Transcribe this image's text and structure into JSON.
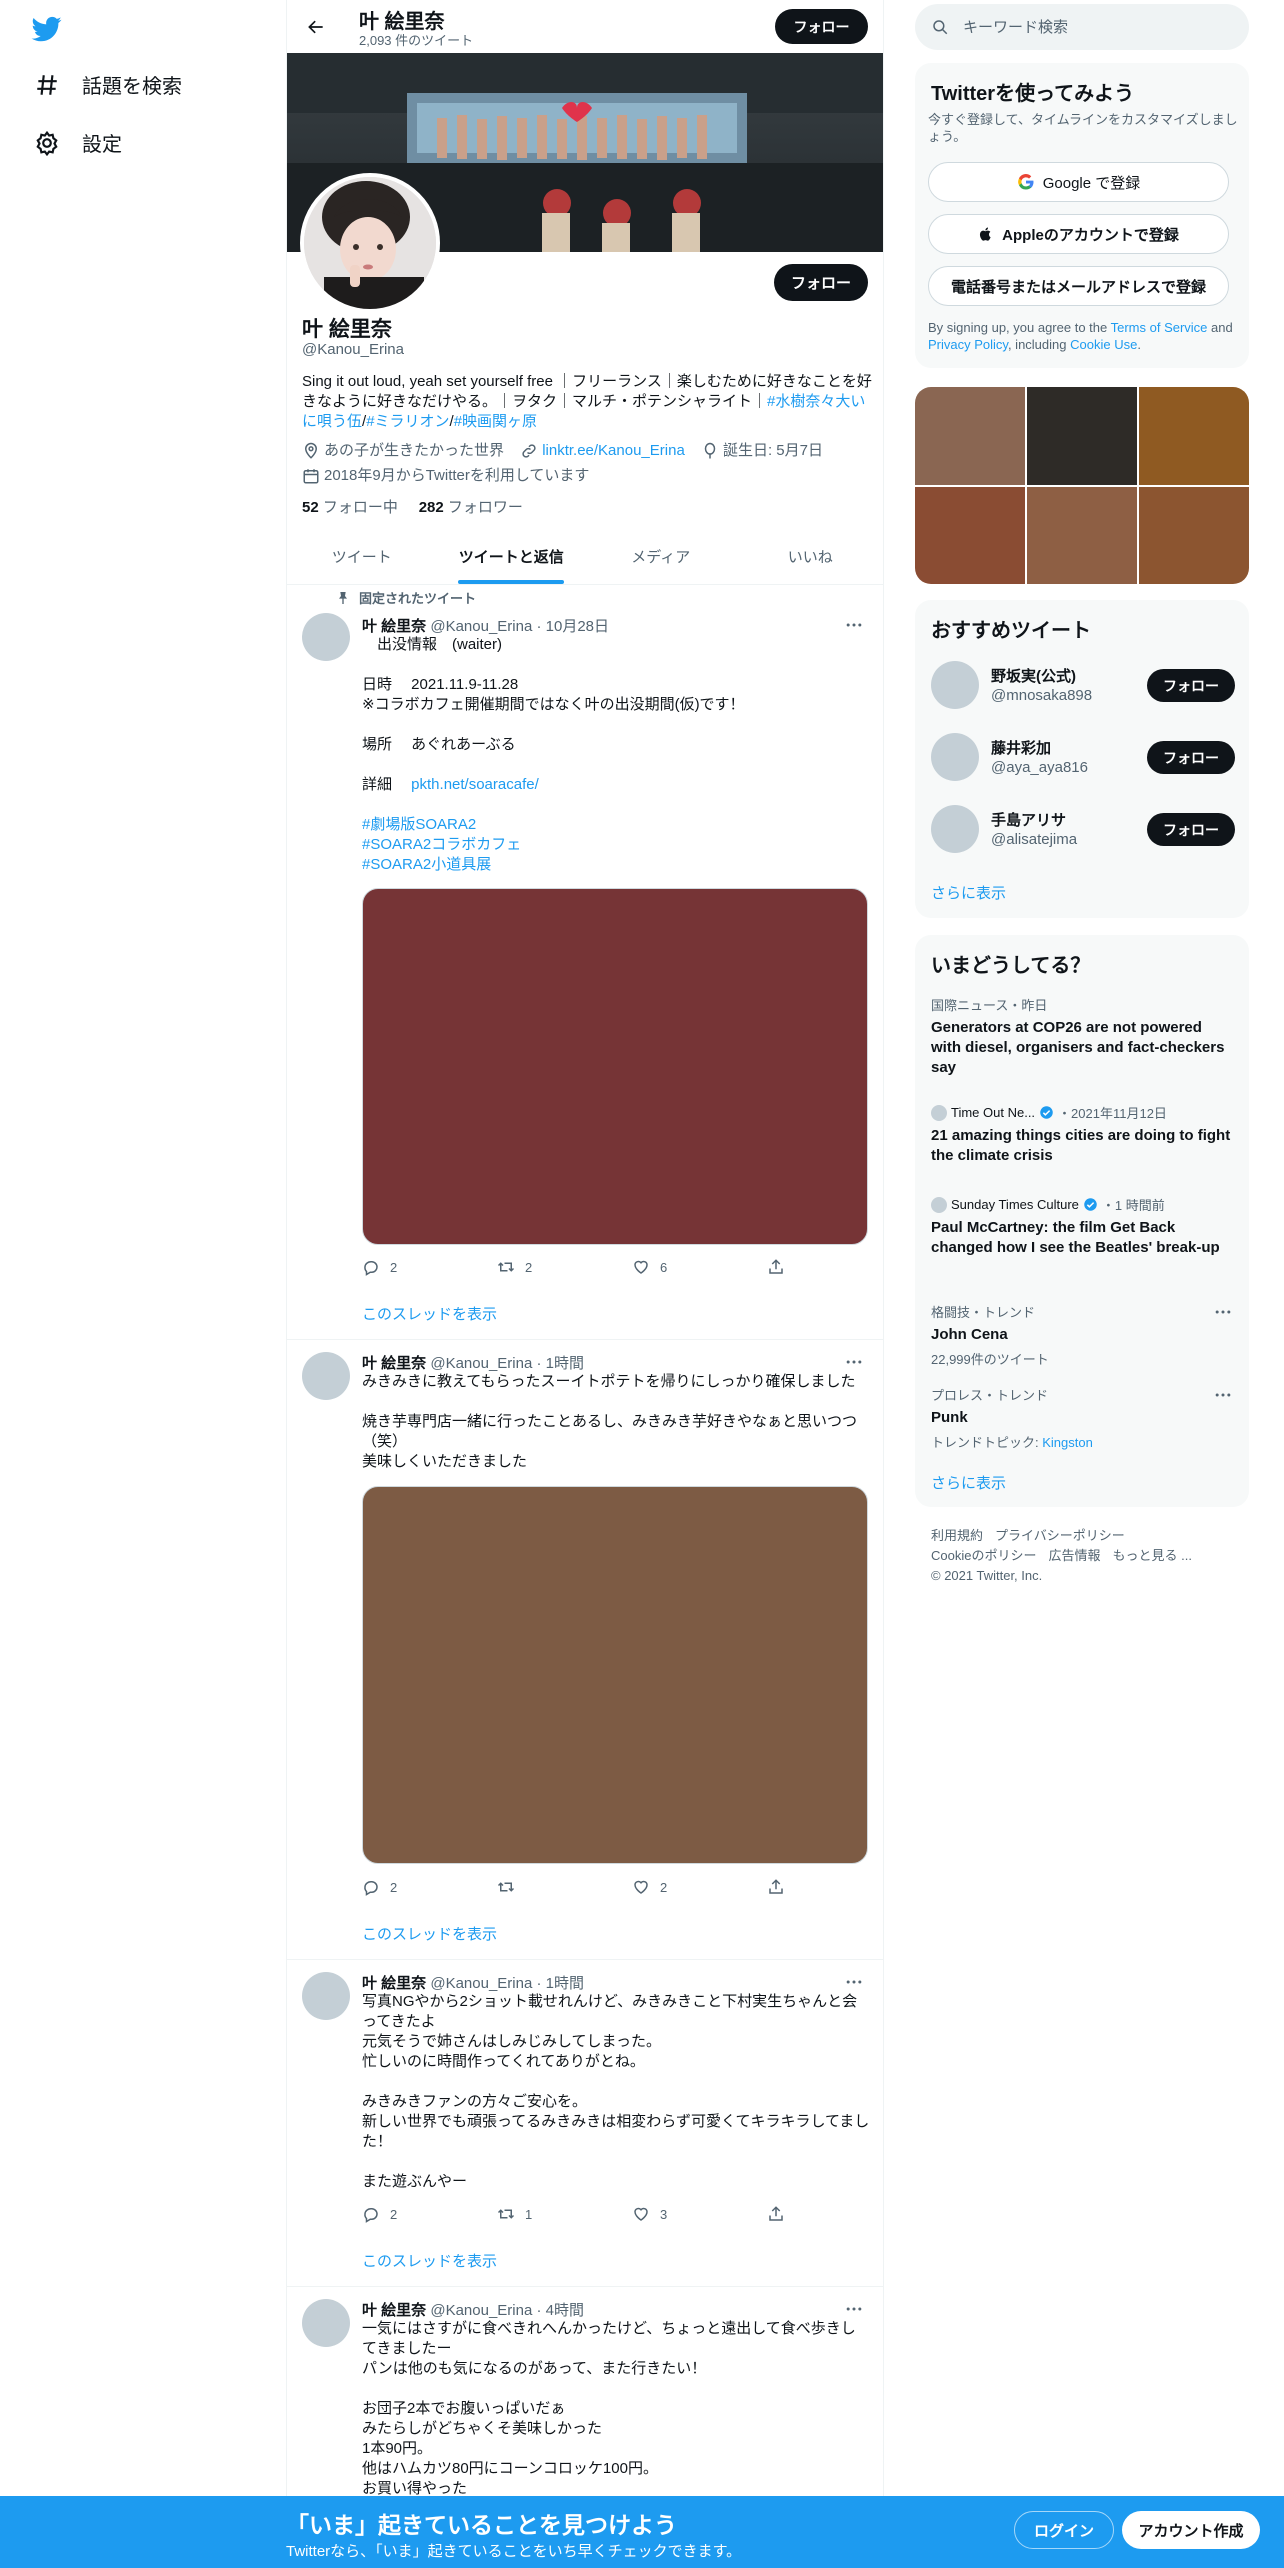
{
  "nav": {
    "explore_label": "話題を検索",
    "settings_label": "設定"
  },
  "header": {
    "name": "叶 絵里奈",
    "tweet_count": "2,093 件のツイート",
    "follow_label": "フォロー"
  },
  "profile": {
    "name": "叶 絵里奈",
    "handle": "@Kanou_Erina",
    "follow_label": "フォロー",
    "bio_text": "Sing it out loud, yeah set yourself free ｜フリーランス｜楽しむために好きなことを好きなように好きなだけやる。｜ヲタク｜マルチ・ポテンシャライト｜",
    "bio_tags": [
      "#水樹奈々大いに唄う伍",
      "#ミラリオン",
      "#映画関ヶ原"
    ],
    "location": "あの子が生きたかった世界",
    "link": "linktr.ee/Kanou_Erina",
    "birthday": "誕生日: 5月7日",
    "joined": "2018年9月からTwitterを利用しています",
    "following_count": "52",
    "following_label": "フォロー中",
    "followers_count": "282",
    "followers_label": "フォロワー"
  },
  "tabs": [
    "ツイート",
    "ツイートと返信",
    "メディア",
    "いいね"
  ],
  "active_tab": "ツイートと返信",
  "pinned_label": "固定されたツイート",
  "tweets": [
    {
      "name": "叶 絵里奈",
      "handle_time": "@Kanou_Erina · 10月28日",
      "text": "　出没情報　(waiter)\n\n日時　 2021.11.9-11.28\n※コラボカフェ開催期間ではなく叶の出没期間(仮)です！\n\n場所　 あぐれあーぶる\n\n詳細　 ",
      "link": "pkth.net/soaracafe/",
      "hashtags": [
        "#劇場版SOARA2",
        "#SOARA2コラボカフェ",
        "#SOARA2小道具展"
      ],
      "media_color": "#763436",
      "replies": "2",
      "retweets": "2",
      "likes": "6",
      "thread_label": "このスレッドを表示"
    },
    {
      "name": "叶 絵里奈",
      "handle_time": "@Kanou_Erina · 1時間",
      "text": "みきみきに教えてもらったスーイトポテトを帰りにしっかり確保しました\n\n焼き芋専門店一緒に行ったことあるし、みきみき芋好きやなぁと思いつつ（笑）\n美味しくいただきました",
      "media_color": "#7d5b44",
      "replies": "2",
      "retweets": "",
      "likes": "2",
      "thread_label": "このスレッドを表示"
    },
    {
      "name": "叶 絵里奈",
      "handle_time": "@Kanou_Erina · 1時間",
      "text": "写真NGやから2ショット載せれんけど、みきみきこと下村実生ちゃんと会ってきたよ\n元気そうで姉さんはしみじみしてしまった。\n忙しいのに時間作ってくれてありがとね。\n\nみきみきファンの方々ご安心を。\n新しい世界でも頑張ってるみきみきは相変わらず可愛くてキラキラしてました！\n\nまた遊ぶんやー",
      "replies": "2",
      "retweets": "1",
      "likes": "3",
      "thread_label": "このスレッドを表示"
    },
    {
      "name": "叶 絵里奈",
      "handle_time": "@Kanou_Erina · 4時間",
      "text": "一気にはさすがに食べきれへんかったけど、ちょっと遠出して食べ歩きしてきましたー\nパンは他のも気になるのがあって、また行きたい！\n\nお団子2本でお腹いっぱいだぁ\nみたらしがどちゃくそ美味しかった\n1本90円。\n他はハムカツ80円にコーンコロッケ100円。\nお買い得やった"
    }
  ],
  "search": {
    "placeholder": "キーワード検索"
  },
  "signup_card": {
    "title": "Twitterを使ってみよう",
    "subtitle": "今すぐ登録して、タイムラインをカスタマイズしましょう。",
    "google_label": "Google で登録",
    "apple_label": "Appleのアカウントで登録",
    "phone_label": "電話番号またはメールアドレスで登録",
    "terms_prefix": "By signing up, you agree to the ",
    "terms_link": "Terms of Service",
    "terms_and": " and ",
    "privacy_link": "Privacy Policy",
    "terms_including": ", including ",
    "cookie_link": "Cookie Use",
    "terms_end": "."
  },
  "photo_grid_colors": [
    "#8a6652",
    "#2e2b27",
    "#8f5a22",
    "#8a4c33",
    "#8e5f44",
    "#8c5530"
  ],
  "recommended": {
    "title": "おすすめツイート",
    "users": [
      {
        "name": "野坂実(公式)",
        "handle": "@mnosaka898",
        "follow": "フォロー"
      },
      {
        "name": "藤井彩加",
        "handle": "@aya_aya816",
        "follow": "フォロー"
      },
      {
        "name": "手島アリサ",
        "handle": "@alisatejima",
        "follow": "フォロー"
      }
    ],
    "more_label": "さらに表示"
  },
  "trends": {
    "title": "いまどうしてる？",
    "items": [
      {
        "meta": "国際ニュース・昨日",
        "title": "Generators at COP26 are not powered with diesel, organisers and fact-checkers say"
      },
      {
        "source": "Time Out Ne...",
        "time": "・2021年11月12日",
        "title": "21 amazing things cities are doing to fight the climate crisis"
      },
      {
        "source": "Sunday Times Culture",
        "time": "・1 時間前",
        "title": "Paul McCartney: the film Get Back changed how I see the Beatles' break-up"
      },
      {
        "meta": "格闘技・トレンド",
        "title": "John Cena",
        "sub": "22,999件のツイート"
      },
      {
        "meta": "プロレス・トレンド",
        "title": "Punk",
        "sub_prefix": "トレンドトピック: ",
        "sub_link": "Kingston"
      }
    ],
    "more_label": "さらに表示"
  },
  "footer": {
    "line1": [
      "利用規約",
      "プライバシーポリシー"
    ],
    "line2": [
      "Cookieのポリシー",
      "広告情報",
      "もっと見る ..."
    ],
    "copyright": "© 2021 Twitter, Inc."
  },
  "bottom_bar": {
    "title": "「いま」起きていることを見つけよう",
    "subtitle": "Twitterなら、「いま」起きていることをいち早くチェックできます。",
    "login_label": "ログイン",
    "signup_label": "アカウント作成"
  },
  "colors": {
    "accent": "#1d9bf0",
    "dark": "#0f1419",
    "muted": "#536471"
  }
}
